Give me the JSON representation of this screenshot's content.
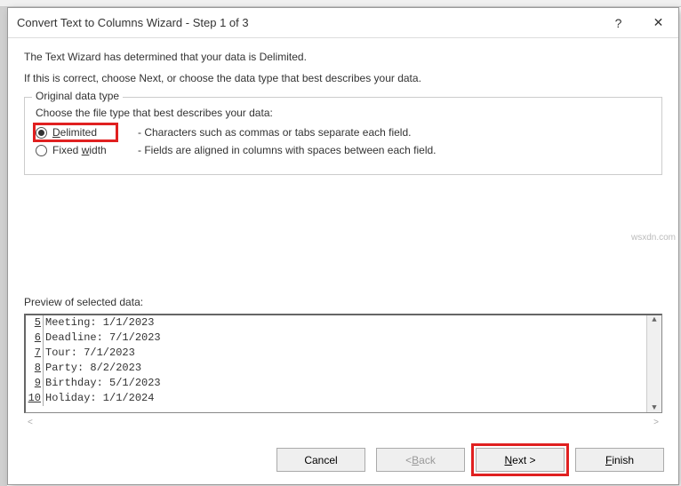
{
  "titlebar": {
    "title": "Convert Text to Columns Wizard - Step 1 of 3",
    "help": "?",
    "close": "✕"
  },
  "intro": {
    "line1": "The Text Wizard has determined that your data is Delimited.",
    "line2": "If this is correct, choose Next, or choose the data type that best describes your data."
  },
  "fieldset": {
    "legend": "Original data type",
    "choose": "Choose the file type that best describes your data:",
    "options": [
      {
        "pre": "",
        "ul": "D",
        "post": "elimited",
        "desc": "- Characters such as commas or tabs separate each field.",
        "checked": true
      },
      {
        "pre": "Fixed ",
        "ul": "w",
        "post": "idth",
        "desc": "- Fields are aligned in columns with spaces between each field.",
        "checked": false
      }
    ]
  },
  "preview": {
    "label": "Preview of selected data:",
    "rows": [
      {
        "num": "5",
        "text": "Meeting: 1/1/2023"
      },
      {
        "num": "6",
        "text": "Deadline: 7/1/2023"
      },
      {
        "num": "7",
        "text": "Tour: 7/1/2023"
      },
      {
        "num": "8",
        "text": "Party: 8/2/2023"
      },
      {
        "num": "9",
        "text": "Birthday: 5/1/2023"
      },
      {
        "num": "10",
        "text": "Holiday: 1/1/2024"
      }
    ]
  },
  "buttons": {
    "cancel": "Cancel",
    "back_pre": "< ",
    "back_ul": "B",
    "back_post": "ack",
    "next_ul": "N",
    "next_post": "ext >",
    "finish_ul": "F",
    "finish_post": "inish"
  },
  "watermark": "wsxdn.com"
}
